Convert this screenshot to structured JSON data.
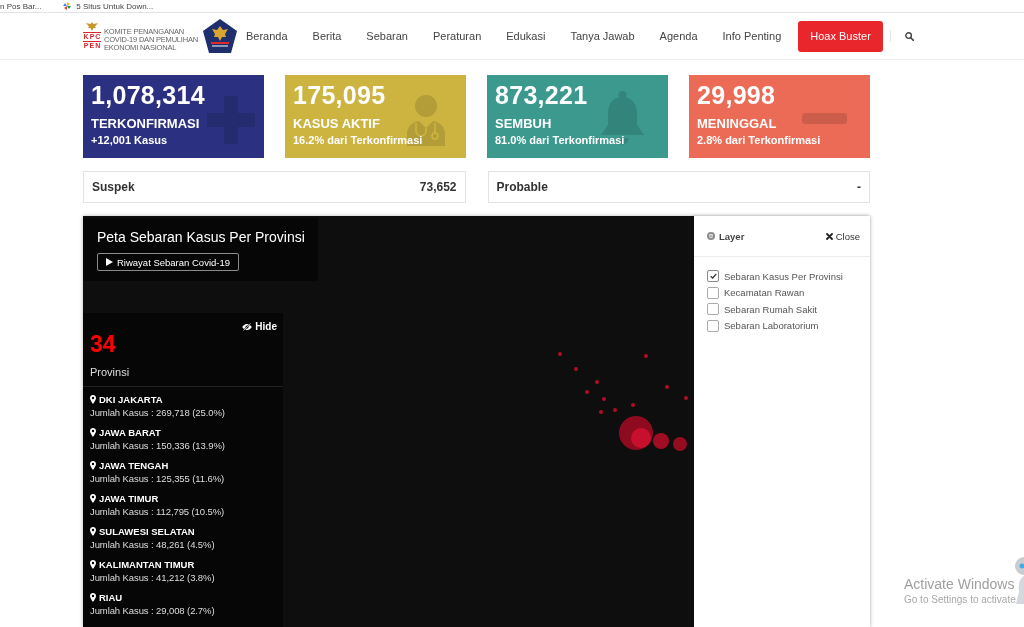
{
  "bookmarks": [
    {
      "label": "n Pos Bar...",
      "icon": false
    },
    {
      "label": "5 Situs Untuk Down...",
      "icon": true
    }
  ],
  "header": {
    "logo": {
      "letters": [
        "KPC",
        "PEN"
      ],
      "tagline": [
        "KOMITE PENANGANAN",
        "COVID-19 DAN PEMULIHAN",
        "EKONOMI NASIONAL"
      ]
    },
    "nav": [
      {
        "label": "Beranda",
        "kind": "link"
      },
      {
        "label": "Berita",
        "kind": "link"
      },
      {
        "label": "Sebaran",
        "kind": "link"
      },
      {
        "label": "Peraturan",
        "kind": "link"
      },
      {
        "label": "Edukasi",
        "kind": "link"
      },
      {
        "label": "Tanya Jawab",
        "kind": "link"
      },
      {
        "label": "Agenda",
        "kind": "link"
      },
      {
        "label": "Info Penting",
        "kind": "link"
      },
      {
        "label": "Hoax Buster",
        "kind": "button"
      }
    ]
  },
  "stats": [
    {
      "kind": "confirmed",
      "value": "1,078,314",
      "label": "TERKONFIRMASI",
      "note": "+12,001 Kasus",
      "color": "#2b3180"
    },
    {
      "kind": "active",
      "value": "175,095",
      "label": "KASUS AKTIF",
      "note": "16.2% dari Terkonfirmasi",
      "color": "#cdb441"
    },
    {
      "kind": "recovered",
      "value": "873,221",
      "label": "SEMBUH",
      "note": "81.0% dari Terkonfirmasi",
      "color": "#3b998e"
    },
    {
      "kind": "deaths",
      "value": "29,998",
      "label": "MENINGGAL",
      "note": "2.8% dari Terkonfirmasi",
      "color": "#ec6b56"
    }
  ],
  "summary": [
    {
      "label": "Suspek",
      "value": "73,652"
    },
    {
      "label": "Probable",
      "value": "-"
    }
  ],
  "map": {
    "title": "Peta Sebaran Kasus Per Provinsi",
    "history_button": "Riwayat Sebaran Covid-19",
    "province_panel": {
      "count": "34",
      "count_label": "Provinsi",
      "hide_label": "Hide",
      "provinces": [
        {
          "name": "DKI JAKARTA",
          "cases": "Jumlah Kasus : 269,718 (25.0%)"
        },
        {
          "name": "JAWA BARAT",
          "cases": "Jumlah Kasus : 150,336 (13.9%)"
        },
        {
          "name": "JAWA TENGAH",
          "cases": "Jumlah Kasus : 125,355 (11.6%)"
        },
        {
          "name": "JAWA TIMUR",
          "cases": "Jumlah Kasus : 112,795 (10.5%)"
        },
        {
          "name": "SULAWESI SELATAN",
          "cases": "Jumlah Kasus : 48,261 (4.5%)"
        },
        {
          "name": "KALIMANTAN TIMUR",
          "cases": "Jumlah Kasus : 41,212 (3.8%)"
        },
        {
          "name": "RIAU",
          "cases": "Jumlah Kasus : 29,008 (2.7%)"
        }
      ]
    },
    "layer_panel": {
      "title": "Layer",
      "close_label": "Close",
      "layers": [
        {
          "label": "Sebaran Kasus Per Provinsi",
          "checked": true
        },
        {
          "label": "Kecamatan Rawan",
          "checked": false
        },
        {
          "label": "Sebaran Rumah Sakit",
          "checked": false
        },
        {
          "label": "Sebaran Laboratorium",
          "checked": false
        }
      ]
    }
  },
  "os_notice": {
    "title": "Activate Windows",
    "text": "Go to Settings to activate"
  }
}
